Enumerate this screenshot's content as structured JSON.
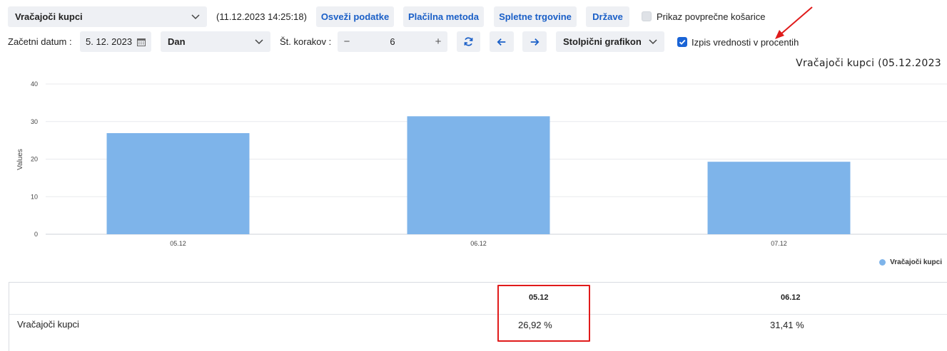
{
  "toolbar": {
    "report_select": "Vračajoči kupci",
    "timestamp": "(11.12.2023 14:25:18)",
    "refresh_label": "Osveži podatke",
    "payment_label": "Plačilna metoda",
    "stores_label": "Spletne trgovine",
    "countries_label": "Države",
    "avg_basket_label": "Prikaz povprečne košarice",
    "avg_basket_checked": false
  },
  "controls": {
    "start_date_label": "Začetni datum :",
    "start_date_value": "5. 12. 2023",
    "period_select": "Dan",
    "steps_label": "Št. korakov :",
    "steps_value": "6",
    "chart_type_select": "Stolpični grafikon",
    "percent_label": "Izpis vrednosti v procentih",
    "percent_checked": true
  },
  "chart_title": "Vračajoči kupci (05.12.2023",
  "chart_data": {
    "type": "bar",
    "categories": [
      "05.12",
      "06.12",
      "07.12"
    ],
    "series": [
      {
        "name": "Vračajoči kupci",
        "values": [
          26.92,
          31.41,
          19.3
        ]
      }
    ],
    "ylabel": "Values",
    "ylim": [
      0,
      40
    ],
    "yticks": [
      0,
      10,
      20,
      30,
      40
    ],
    "grid": true,
    "legend": "bottom-right",
    "color": "#7eb4ea"
  },
  "table": {
    "columns": [
      "",
      "05.12",
      "06.12"
    ],
    "rows": [
      {
        "label": "Vračajoči kupci",
        "values": [
          "26,92 %",
          "31,41 %"
        ]
      }
    ]
  },
  "colors": {
    "accent": "#1a5fc7",
    "checkbox_on": "#1a64d6",
    "annotation": "#e01b1b"
  }
}
